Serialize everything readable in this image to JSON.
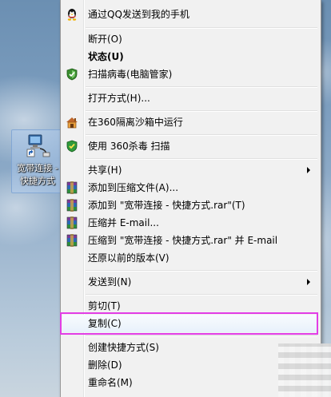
{
  "desktop": {
    "shortcut_label": "宽带连接 - 快捷方式",
    "highlight_color": "#e23de6"
  },
  "menu": {
    "items": [
      {
        "label": "通过QQ发送到我的手机",
        "icon": "qq-penguin-icon"
      },
      {
        "label": "断开(O)"
      },
      {
        "label": "状态(U)",
        "bold": true
      },
      {
        "label": "扫描病毒(电脑管家)",
        "icon": "shield-scan-icon"
      },
      {
        "label": "打开方式(H)..."
      },
      {
        "label": "在360隔离沙箱中运行",
        "icon": "sandbox-icon"
      },
      {
        "label": "使用 360杀毒 扫描",
        "icon": "antivirus-shield-icon"
      },
      {
        "label": "共享(H)",
        "submenu": true
      },
      {
        "label": "添加到压缩文件(A)...",
        "icon": "winrar-icon"
      },
      {
        "label": "添加到 \"宽带连接 - 快捷方式.rar\"(T)",
        "icon": "winrar-icon"
      },
      {
        "label": "压缩并 E-mail...",
        "icon": "winrar-icon"
      },
      {
        "label": "压缩到 \"宽带连接 - 快捷方式.rar\" 并 E-mail",
        "icon": "winrar-icon"
      },
      {
        "label": "还原以前的版本(V)"
      },
      {
        "label": "发送到(N)",
        "submenu": true
      },
      {
        "label": "剪切(T)"
      },
      {
        "label": "复制(C)"
      },
      {
        "label": "创建快捷方式(S)"
      },
      {
        "label": "删除(D)"
      },
      {
        "label": "重命名(M)"
      }
    ]
  }
}
